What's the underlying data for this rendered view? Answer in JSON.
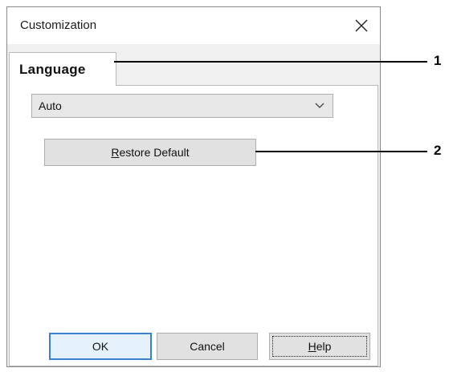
{
  "window": {
    "title": "Customization"
  },
  "tabs": [
    {
      "label": "Language",
      "active": true
    }
  ],
  "language_select": {
    "value": "Auto"
  },
  "buttons": {
    "restore_prefix": "",
    "restore_accel": "R",
    "restore_rest": "estore Default",
    "ok": "OK",
    "cancel": "Cancel",
    "help_accel": "H",
    "help_rest": "elp"
  },
  "callouts": [
    {
      "number": "1"
    },
    {
      "number": "2"
    }
  ],
  "colors": {
    "focus_border": "#3c7fd6",
    "window_bg": "#f0f0f0",
    "panel_bg": "#ffffff"
  },
  "icons": {
    "close": "close-icon",
    "dropdown": "chevron-down-icon"
  }
}
